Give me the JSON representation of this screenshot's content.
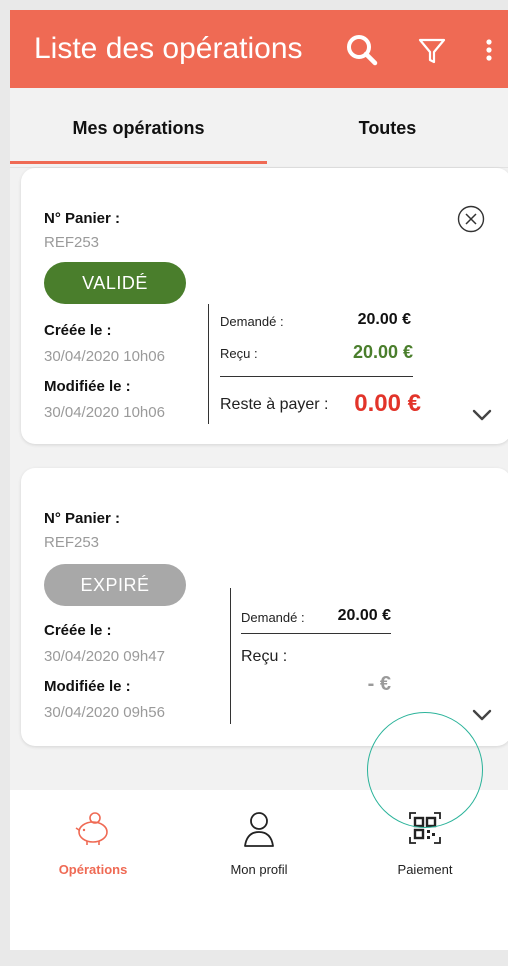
{
  "header": {
    "title": "Liste des opérations",
    "search_icon": "search-icon",
    "filter_icon": "filter-icon",
    "more_icon": "more-vertical-icon"
  },
  "tabs": [
    {
      "label": "Mes opérations",
      "active": true
    },
    {
      "label": "Toutes",
      "active": false
    }
  ],
  "operations": [
    {
      "cart_label": "N° Panier :",
      "cart_ref": "REF253",
      "status": "VALIDÉ",
      "created_label": "Créée le :",
      "created_value": "30/04/2020 10h06",
      "modified_label": "Modifiée le :",
      "modified_value": "30/04/2020 10h06",
      "requested_label": "Demandé :",
      "requested_value": "20.00 €",
      "received_label": "Reçu :",
      "received_value": "20.00 €",
      "remaining_label": "Reste à payer :",
      "remaining_value": "0.00 €"
    },
    {
      "cart_label": "N° Panier :",
      "cart_ref": "REF253",
      "status": "EXPIRÉ",
      "created_label": "Créée le :",
      "created_value": "30/04/2020 09h47",
      "modified_label": "Modifiée le :",
      "modified_value": "30/04/2020 09h56",
      "requested_label": "Demandé :",
      "requested_value": "20.00 €",
      "received_label": "Reçu :",
      "received_value": "- €"
    }
  ],
  "bottom_nav": [
    {
      "label": "Opérations",
      "icon": "piggy-bank-icon",
      "active": true
    },
    {
      "label": "Mon profil",
      "icon": "user-icon",
      "active": false
    },
    {
      "label": "Paiement",
      "icon": "qr-code-icon",
      "active": false
    }
  ],
  "colors": {
    "accent": "#ef6a54",
    "validated": "#4a7e2c",
    "expired": "#a8a8a8",
    "negative": "#e2342a",
    "highlight": "#2bb39a"
  }
}
